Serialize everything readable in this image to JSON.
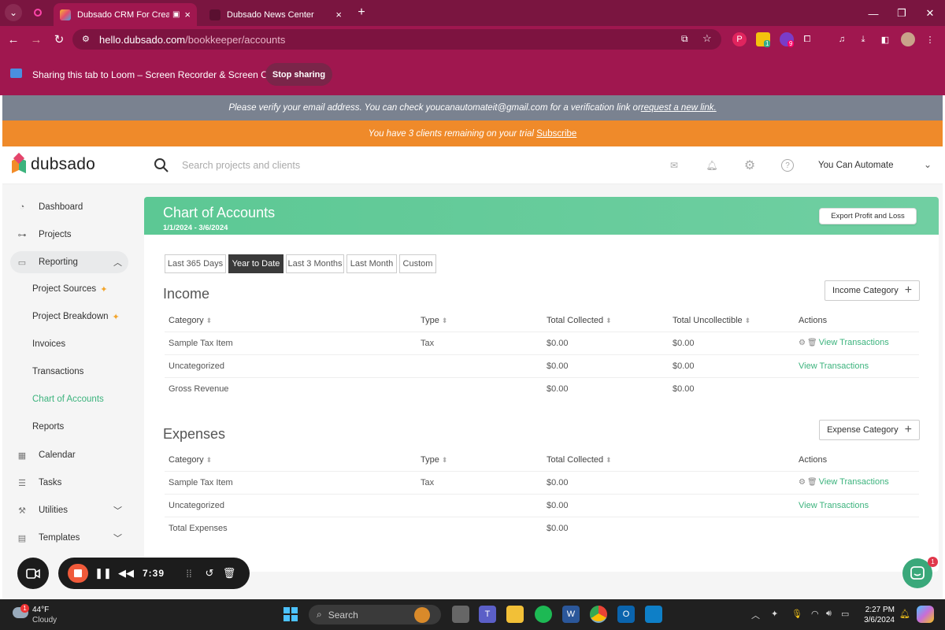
{
  "browser": {
    "tabs": [
      {
        "title": "Dubsado CRM For Creatives",
        "active": true
      },
      {
        "title": "Dubsado News Center",
        "active": false
      }
    ],
    "url_host": "hello.dubsado.com",
    "url_path": "/bookkeeper/accounts",
    "share_text": "Sharing this tab to Loom – Screen Recorder & Screen Capture",
    "stop_sharing": "Stop sharing",
    "ext_badges": [
      "1",
      "9"
    ]
  },
  "banners": {
    "verify_text": "Please verify your email address. You can check youcanautomateit@gmail.com for a verification link or ",
    "verify_link": "request a new link.",
    "trial_text": "You have 3 clients remaining on your trial ",
    "trial_link": "Subscribe"
  },
  "header": {
    "logo": "dubsado",
    "search_placeholder": "Search projects and clients",
    "user": "You Can Automate"
  },
  "sidebar": {
    "items": [
      {
        "label": "Dashboard",
        "icon": "dashboard-icon"
      },
      {
        "label": "Projects",
        "icon": "projects-icon"
      },
      {
        "label": "Reporting",
        "icon": "reporting-icon"
      },
      {
        "label": "Calendar",
        "icon": "calendar-icon"
      },
      {
        "label": "Tasks",
        "icon": "tasks-icon"
      },
      {
        "label": "Utilities",
        "icon": "utilities-icon"
      },
      {
        "label": "Templates",
        "icon": "templates-icon"
      }
    ],
    "subitems": [
      {
        "label": "Project Sources"
      },
      {
        "label": "Project Breakdown"
      },
      {
        "label": "Invoices"
      },
      {
        "label": "Transactions"
      },
      {
        "label": "Chart of Accounts"
      },
      {
        "label": "Reports"
      }
    ]
  },
  "main": {
    "title": "Chart of Accounts",
    "date_range": "1/1/2024 - 3/6/2024",
    "export_button": "Export Profit and Loss",
    "ranges": [
      "Last 365 Days",
      "Year to Date",
      "Last 3 Months",
      "Last Month",
      "Custom"
    ],
    "selected_range": "Year to Date",
    "income": {
      "title": "Income",
      "add_button": "Income Category",
      "columns": [
        "Category",
        "Type",
        "Total Collected",
        "Total Uncollectible",
        "Actions"
      ],
      "rows": [
        {
          "category": "Sample Tax Item",
          "type": "Tax",
          "collected": "$0.00",
          "uncollectible": "$0.00",
          "action": "View Transactions"
        },
        {
          "category": "Uncategorized",
          "type": "",
          "collected": "$0.00",
          "uncollectible": "$0.00",
          "action": "View Transactions"
        },
        {
          "category": "Gross Revenue",
          "type": "",
          "collected": "$0.00",
          "uncollectible": "$0.00",
          "action": ""
        }
      ]
    },
    "expenses": {
      "title": "Expenses",
      "add_button": "Expense Category",
      "columns": [
        "Category",
        "Type",
        "Total Collected",
        "Actions"
      ],
      "rows": [
        {
          "category": "Sample Tax Item",
          "type": "Tax",
          "collected": "$0.00",
          "action": "View Transactions"
        },
        {
          "category": "Uncategorized",
          "type": "",
          "collected": "$0.00",
          "action": "View Transactions"
        },
        {
          "category": "Total Expenses",
          "type": "",
          "collected": "$0.00",
          "action": ""
        }
      ]
    }
  },
  "loom": {
    "time": "7:39"
  },
  "chat": {
    "badge": "1"
  },
  "taskbar": {
    "weather_temp": "44°F",
    "weather_desc": "Cloudy",
    "weather_badge": "1",
    "search": "Search",
    "time": "2:27 PM",
    "date": "3/6/2024"
  },
  "colors": {
    "brand_green": "#3cb37d",
    "browser": "#a0174f",
    "trial": "#ef8a2a"
  }
}
